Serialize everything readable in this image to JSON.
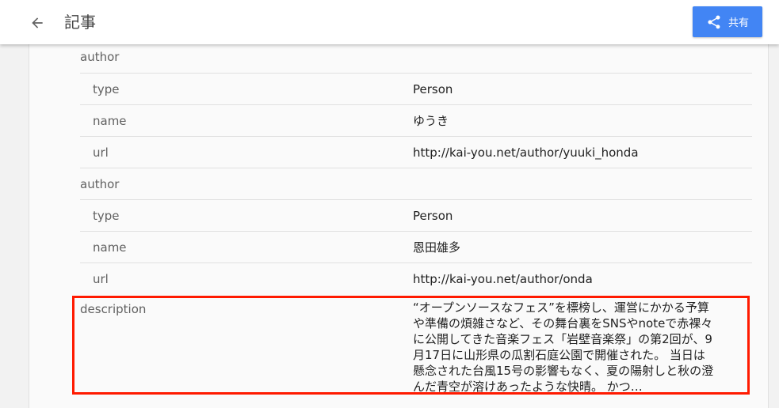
{
  "appbar": {
    "title": "記事",
    "share_label": "共有"
  },
  "author_blocks": [
    {
      "label": "author",
      "props": [
        {
          "key": "type",
          "value": "Person"
        },
        {
          "key": "name",
          "value": "ゆうき"
        },
        {
          "key": "url",
          "value": "http://kai-you.net/author/yuuki_honda"
        }
      ]
    },
    {
      "label": "author",
      "props": [
        {
          "key": "type",
          "value": "Person"
        },
        {
          "key": "name",
          "value": "恩田雄多"
        },
        {
          "key": "url",
          "value": "http://kai-you.net/author/onda"
        }
      ]
    }
  ],
  "description": {
    "key": "description",
    "lines": [
      "“オープンソースなフェス”を標榜し、運営にかかる予算",
      "や準備の煩雑さなど、その舞台裏をSNSやnoteで赤裸々",
      "に公開してきた音楽フェス「岩壁音楽祭」の第2回が、9",
      "月17日に山形県の瓜割石庭公園で開催された。 当日は",
      "懸念された台風15号の影響もなく、夏の陽射しと秋の澄",
      "んだ青空が溶けあったような快晴。 かつ…"
    ]
  },
  "highlight_color": "#ff1a00",
  "accent_color": "#4285f4"
}
